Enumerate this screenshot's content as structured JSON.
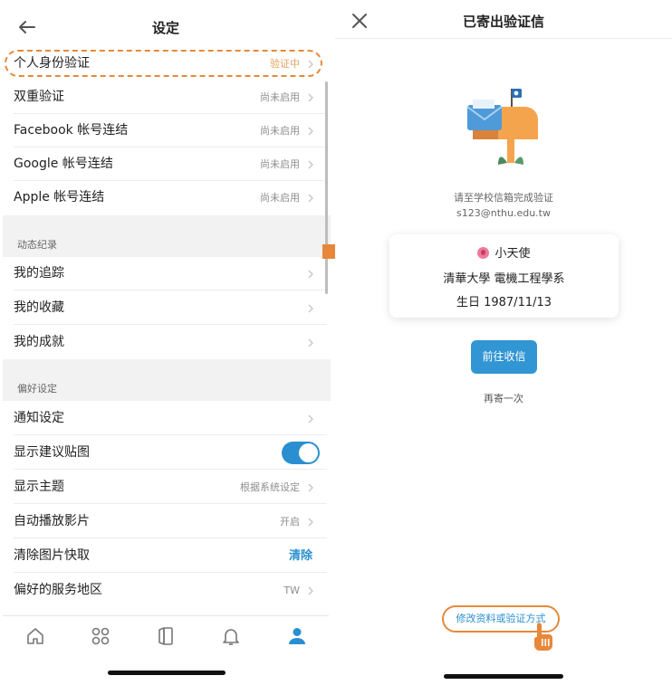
{
  "left": {
    "title": "设定",
    "rows": [
      {
        "label": "个人身份验证",
        "value": "验证中"
      },
      {
        "label": "双重验证",
        "value": "尚未启用"
      },
      {
        "label": "Facebook 帐号连结",
        "value": "尚未启用"
      },
      {
        "label": "Google 帐号连结",
        "value": "尚未启用"
      },
      {
        "label": "Apple 帐号连结",
        "value": "尚未启用"
      }
    ],
    "section_activity": "动态纪录",
    "activity_rows": [
      {
        "label": "我的追踪"
      },
      {
        "label": "我的收藏"
      },
      {
        "label": "我的成就"
      }
    ],
    "section_prefs": "偏好设定",
    "pref_rows": [
      {
        "label": "通知设定",
        "value": ""
      },
      {
        "label": "显示建议贴图",
        "value": ""
      },
      {
        "label": "显示主题",
        "value": "根据系统设定"
      },
      {
        "label": "自动播放影片",
        "value": "开启"
      },
      {
        "label": "清除图片快取",
        "value": "清除"
      },
      {
        "label": "偏好的服务地区",
        "value": "TW"
      }
    ],
    "tabs": [
      "home-icon",
      "grid-icon",
      "boards-icon",
      "bell-icon",
      "profile-icon"
    ],
    "colors": {
      "accent": "#2a8fd1",
      "highlight": "#e58a3b",
      "pending": "#e6a35e"
    }
  },
  "right": {
    "title": "已寄出验证信",
    "instruction": "请至学校信箱完成验证",
    "email": "s123@nthu.edu.tw",
    "card": {
      "name": "小天使",
      "school": "清華大學 電機工程學系",
      "birthday": "生日 1987/11/13"
    },
    "goto_button": "前往收信",
    "resend": "再寄一次",
    "modify_link": "修改资料或验证方式"
  }
}
